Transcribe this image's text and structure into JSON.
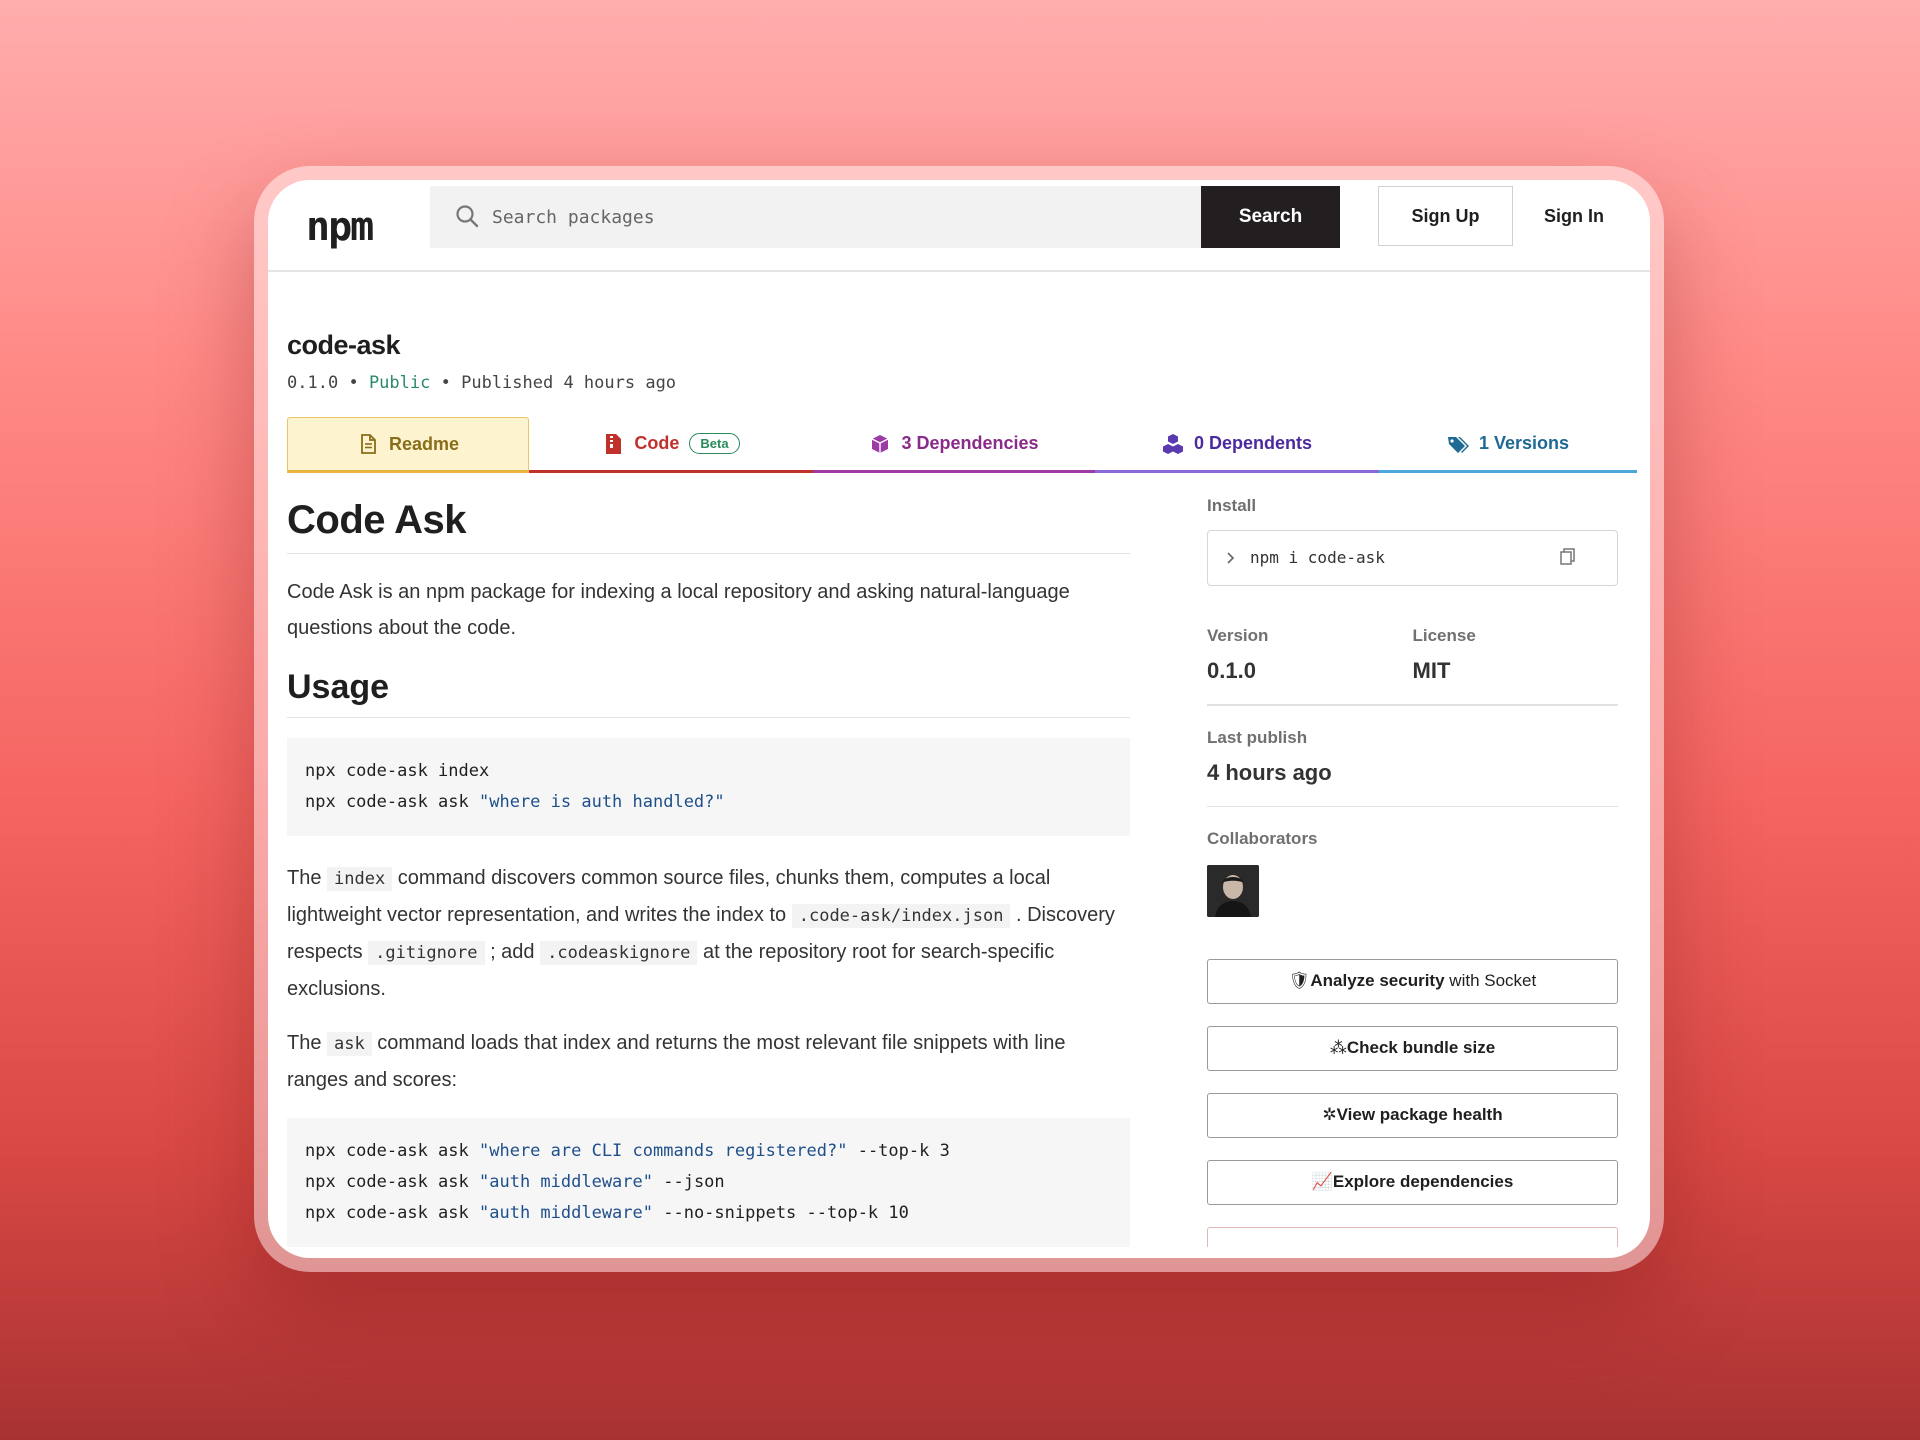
{
  "header": {
    "logo": "npm",
    "search_placeholder": "Search packages",
    "search_button": "Search",
    "signup": "Sign Up",
    "signin": "Sign In"
  },
  "package": {
    "name": "code-ask",
    "version": "0.1.0",
    "sep": "•",
    "visibility": "Public",
    "published": "Published 4 hours ago"
  },
  "tabs": [
    {
      "label": "Readme",
      "icon": "document-icon"
    },
    {
      "label": "Code",
      "badge": "Beta",
      "icon": "file-zip-icon"
    },
    {
      "label": "3 Dependencies",
      "icon": "box-icon"
    },
    {
      "label": "0 Dependents",
      "icon": "boxes-icon"
    },
    {
      "label": "1 Versions",
      "icon": "tags-icon"
    }
  ],
  "readme": {
    "title": "Code Ask",
    "intro": "Code Ask is an npm package for indexing a local repository and asking natural-language questions about the code.",
    "usage_heading": "Usage",
    "code1": {
      "l1": "npx code-ask index",
      "l2_cmd": "npx code-ask ask ",
      "l2_str": "\"where is auth handled?\""
    },
    "p2": {
      "a": "The ",
      "code_index": "index",
      "b": " command discovers common source files, chunks them, computes a local lightweight vector representation, and writes the index to ",
      "code_path": ".code-ask/index.json",
      "c": " . Discovery respects ",
      "code_gitignore": ".gitignore",
      "d": " ; add ",
      "code_codeaskignore": ".codeaskignore",
      "e": " at the repository root for search-specific exclusions."
    },
    "p3": {
      "a": "The ",
      "code_ask": "ask",
      "b": " command loads that index and returns the most relevant file snippets with line ranges and scores:"
    },
    "code2": {
      "l1_cmd": "npx code-ask ask ",
      "l1_str": "\"where are CLI commands registered?\"",
      "l1_tail": " --top-k 3",
      "l2_cmd": "npx code-ask ask ",
      "l2_str": "\"auth middleware\"",
      "l2_tail": " --json",
      "l3_cmd": "npx code-ask ask ",
      "l3_str": "\"auth middleware\"",
      "l3_tail": " --no-snippets --top-k 10"
    }
  },
  "sidebar": {
    "install_label": "Install",
    "install_cmd": "npm i code-ask",
    "version_label": "Version",
    "version_value": "0.1.0",
    "license_label": "License",
    "license_value": "MIT",
    "last_publish_label": "Last publish",
    "last_publish_value": "4 hours ago",
    "collaborators_label": "Collaborators",
    "buttons": {
      "security_bold": "Analyze security",
      "security_rest": " with Socket",
      "bundle": "Check bundle size",
      "health": "View package health",
      "explore": "Explore dependencies"
    }
  }
}
